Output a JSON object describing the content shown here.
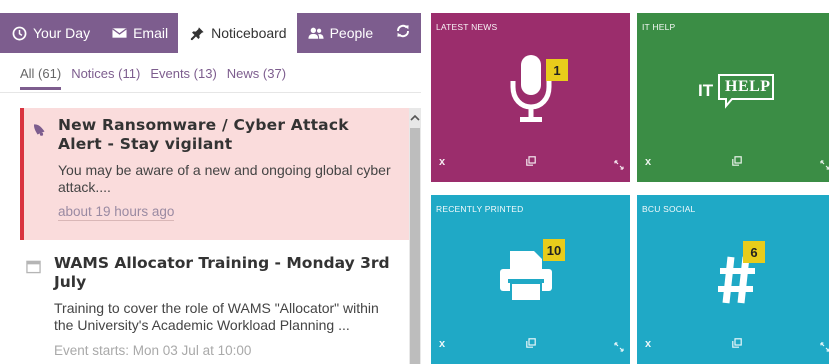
{
  "nav": {
    "tabs": [
      {
        "label": "Your Day",
        "icon": "clock-icon"
      },
      {
        "label": "Email",
        "icon": "envelope-icon"
      },
      {
        "label": "Noticeboard",
        "icon": "pin-icon"
      },
      {
        "label": "People",
        "icon": "people-icon"
      }
    ],
    "active_tab": "Noticeboard",
    "refresh_icon": "refresh-icon"
  },
  "filters": [
    {
      "label": "All (61)",
      "active": true
    },
    {
      "label": "Notices (11)"
    },
    {
      "label": "Events (13)"
    },
    {
      "label": "News (37)"
    }
  ],
  "feed": {
    "alert": {
      "title": "New Ransomware / Cyber Attack Alert - Stay vigilant",
      "body": "You may be aware of a new and ongoing global cyber attack....",
      "time": "about 19 hours ago",
      "icon": "megaphone-icon"
    },
    "event": {
      "title": "WAMS Allocator Training - Monday 3rd July",
      "body": "Training to cover the role of WAMS \"Allocator\" within the University's Academic Workload Planning ...",
      "meta": "Event starts: Mon 03 Jul at 10:00",
      "icon": "calendar-icon"
    }
  },
  "tiles": {
    "news": {
      "label": "LATEST NEWS",
      "badge": "1",
      "color": "#9b2d6c",
      "icon": "microphone-icon"
    },
    "ithelp": {
      "label": "IT HELP",
      "logo_text_1": "IT",
      "logo_text_2": "HELP",
      "color": "#3b8d45",
      "icon": "it-help-logo"
    },
    "printed": {
      "label": "RECENTLY PRINTED",
      "badge": "10",
      "color": "#1fa9c6",
      "icon": "printer-icon"
    },
    "social": {
      "label": "BCU SOCIAL",
      "badge": "6",
      "color": "#1fa9c6",
      "icon": "hashtag-icon"
    }
  },
  "tile_controls": {
    "close": "x"
  },
  "colors": {
    "nav": "#7d5d8e",
    "alert_bg": "#fadcdc",
    "alert_border": "#d9343f",
    "badge": "#e8cc1b"
  }
}
